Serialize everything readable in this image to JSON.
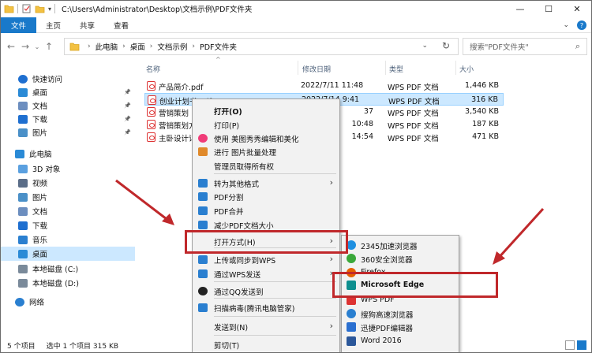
{
  "window": {
    "title_path": "C:\\Users\\Administrator\\Desktop\\文档示例\\PDF文件夹",
    "controls": [
      "—",
      "☐",
      "✕"
    ]
  },
  "ribbon": {
    "tabs": [
      "文件",
      "主页",
      "共享",
      "查看"
    ],
    "help": "?"
  },
  "address": {
    "crumbs": [
      "此电脑",
      "桌面",
      "文档示例",
      "PDF文件夹"
    ],
    "search_placeholder": "搜索\"PDF文件夹\""
  },
  "nav": {
    "items": [
      {
        "label": "快速访问",
        "icon": "star-icon",
        "color": "#1e6fd0"
      },
      {
        "label": "桌面",
        "icon": "desktop-icon",
        "color": "#2a8ad6",
        "pin": true
      },
      {
        "label": "文档",
        "icon": "document-icon",
        "color": "#6c8ebf",
        "pin": true
      },
      {
        "label": "下载",
        "icon": "download-icon",
        "color": "#1e6fd0",
        "pin": true
      },
      {
        "label": "图片",
        "icon": "picture-icon",
        "color": "#4a90c8",
        "pin": true
      },
      {
        "label": "此电脑",
        "icon": "computer-icon",
        "color": "#2a8ad6"
      },
      {
        "label": "3D 对象",
        "icon": "cube-icon",
        "color": "#5aa0e0"
      },
      {
        "label": "视频",
        "icon": "video-icon",
        "color": "#5a6d88"
      },
      {
        "label": "图片",
        "icon": "picture-icon",
        "color": "#4a90c8"
      },
      {
        "label": "文档",
        "icon": "document-icon",
        "color": "#6c8ebf"
      },
      {
        "label": "下载",
        "icon": "download-icon",
        "color": "#1e6fd0"
      },
      {
        "label": "音乐",
        "icon": "music-icon",
        "color": "#2a7fd0"
      },
      {
        "label": "桌面",
        "icon": "desktop-icon",
        "color": "#2a8ad6",
        "selected": true
      },
      {
        "label": "本地磁盘 (C:)",
        "icon": "drive-icon",
        "color": "#7a8a9a"
      },
      {
        "label": "本地磁盘 (D:)",
        "icon": "drive-icon",
        "color": "#7a8a9a"
      },
      {
        "label": "网络",
        "icon": "network-icon",
        "color": "#2a7fd0"
      }
    ]
  },
  "columns": {
    "name": "名称",
    "date": "修改日期",
    "type": "类型",
    "size": "大小"
  },
  "files": [
    {
      "name": "产品简介.pdf",
      "date": "2022/7/11 11:48",
      "type": "WPS PDF 文档",
      "size": "1,446 KB"
    },
    {
      "name": "创业计划书.pdf",
      "date": "2022/7/14 9:41",
      "type": "WPS PDF 文档",
      "size": "316 KB",
      "selected": true
    },
    {
      "name": "营销策划",
      "date": "37",
      "type": "WPS PDF 文档",
      "size": "3,540 KB"
    },
    {
      "name": "营销策划方",
      "date": "10:48",
      "type": "WPS PDF 文档",
      "size": "187 KB"
    },
    {
      "name": "主卧设计详",
      "date": "14:54",
      "type": "WPS PDF 文档",
      "size": "471 KB"
    }
  ],
  "status": {
    "count": "5 个项目",
    "selection": "选中 1 个项目  315 KB"
  },
  "context_menu": {
    "items": [
      {
        "label": "打开(O)",
        "bold": true,
        "icon": ""
      },
      {
        "label": "打印(P)",
        "icon": ""
      },
      {
        "label": "使用 美图秀秀编辑和美化",
        "icon": "meitu-icon",
        "color": "#f03c78"
      },
      {
        "label": "进行 图片批量处理",
        "icon": "batch-image-icon",
        "color": "#e0892a"
      },
      {
        "label": "管理员取得所有权",
        "icon": ""
      },
      {
        "label": "转为其他格式",
        "icon": "convert-icon",
        "color": "#2a7fd0",
        "arrow": true
      },
      {
        "label": "PDF分割",
        "icon": "pdf-split-icon",
        "color": "#2a7fd0"
      },
      {
        "label": "PDF合并",
        "icon": "pdf-merge-icon",
        "color": "#2a7fd0"
      },
      {
        "label": "减少PDF文档大小",
        "icon": "pdf-compress-icon",
        "color": "#2a7fd0"
      },
      {
        "label": "打开方式(H)",
        "icon": "",
        "arrow": true
      },
      {
        "label": "上传或同步到WPS",
        "icon": "cloud-icon",
        "color": "#2a7fd0",
        "arrow": true
      },
      {
        "label": "通过WPS发送",
        "icon": "send-icon",
        "color": "#2a7fd0",
        "arrow": true
      },
      {
        "label": "通过QQ发送到",
        "icon": "qq-icon",
        "color": "#222"
      },
      {
        "label": "扫描病毒(腾讯电脑管家)",
        "icon": "shield-icon",
        "color": "#2a7fd0"
      },
      {
        "label": "发送到(N)",
        "icon": "",
        "arrow": true
      },
      {
        "label": "剪切(T)",
        "icon": ""
      }
    ]
  },
  "submenu": {
    "items": [
      {
        "label": "2345加速浏览器",
        "icon": "browser-2345-icon",
        "color": "#1e8fe0"
      },
      {
        "label": "360安全浏览器",
        "icon": "browser-360-icon",
        "color": "#3aa83a"
      },
      {
        "label": "Firefox",
        "icon": "firefox-icon",
        "color": "#e66000"
      },
      {
        "label": "Microsoft Edge",
        "icon": "edge-icon",
        "color": "#0f8f8f"
      },
      {
        "label": "WPS PDF",
        "icon": "wps-pdf-icon",
        "color": "#d33"
      },
      {
        "label": "搜狗高速浏览器",
        "icon": "sogou-icon",
        "color": "#2a7fd0"
      },
      {
        "label": "迅捷PDF编辑器",
        "icon": "xunjie-pdf-icon",
        "color": "#2a6fd0"
      },
      {
        "label": "Word 2016",
        "icon": "word-icon",
        "color": "#2b579a"
      }
    ]
  },
  "accent": "#c0282b"
}
